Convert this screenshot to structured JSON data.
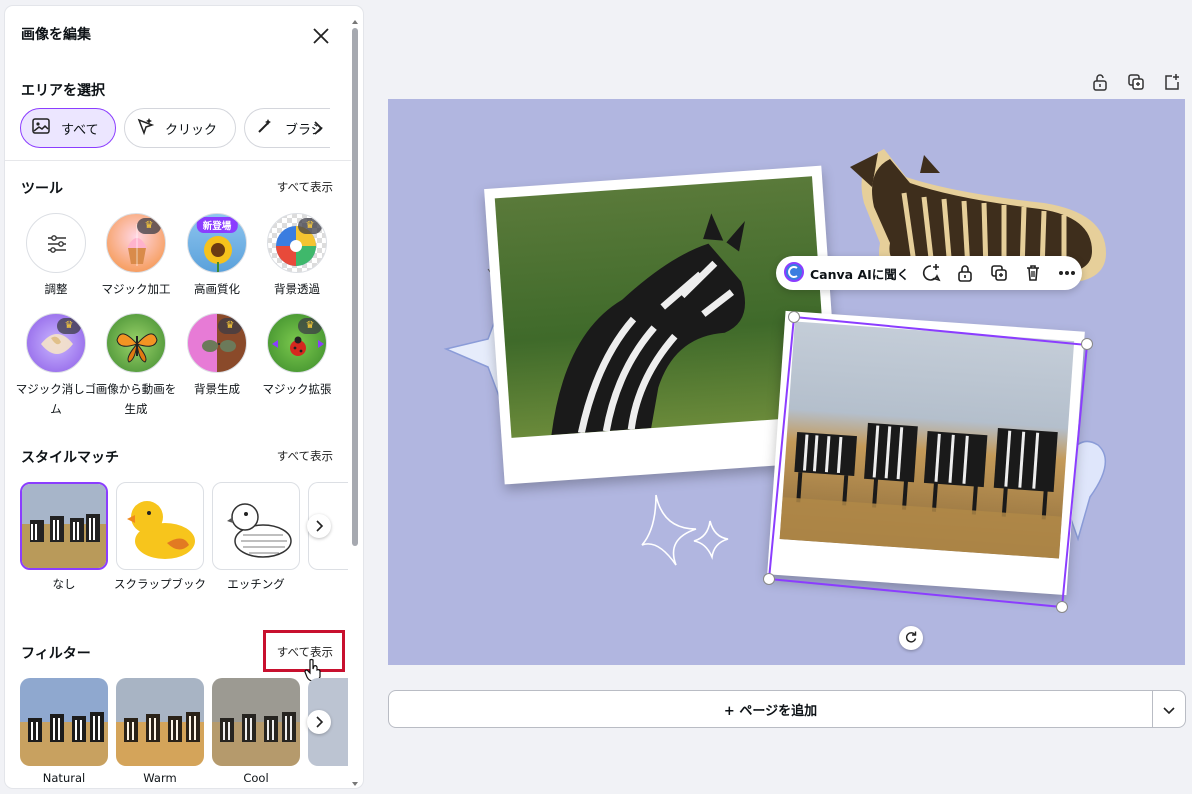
{
  "panel": {
    "title": "画像を編集",
    "area_section": {
      "title": "エリアを選択",
      "buttons": [
        {
          "label": "すべて",
          "icon": "image-icon",
          "active": true
        },
        {
          "label": "クリック",
          "icon": "magic-click-icon",
          "active": false
        },
        {
          "label": "ブラシ",
          "icon": "magic-brush-icon",
          "active": false
        }
      ]
    },
    "tools": {
      "title": "ツール",
      "show_all": "すべて表示",
      "items": [
        {
          "label": "調整",
          "icon": "sliders-icon",
          "premium": false
        },
        {
          "label": "マジック加工",
          "icon": "cupcake-thumbnail",
          "premium": true
        },
        {
          "label": "高画質化",
          "icon": "sunflower-thumbnail",
          "badge": "新登場"
        },
        {
          "label": "背景透過",
          "icon": "beach-ball-thumbnail",
          "premium": true
        },
        {
          "label": "マジック消しゴム",
          "icon": "eraser-thumbnail",
          "premium": true
        },
        {
          "label": "画像から動画を生成",
          "icon": "butterfly-thumbnail",
          "premium": false
        },
        {
          "label": "背景生成",
          "icon": "sunglasses-thumbnail",
          "premium": true
        },
        {
          "label": "マジック拡張",
          "icon": "ladybug-thumbnail",
          "premium": true
        }
      ]
    },
    "style_match": {
      "title": "スタイルマッチ",
      "show_all": "すべて表示",
      "items": [
        {
          "label": "なし",
          "selected": true
        },
        {
          "label": "スクラップブック",
          "selected": false
        },
        {
          "label": "エッチング",
          "selected": false
        }
      ]
    },
    "filters": {
      "title": "フィルター",
      "show_all": "すべて表示",
      "items": [
        {
          "label": "Natural"
        },
        {
          "label": "Warm"
        },
        {
          "label": "Cool"
        }
      ]
    }
  },
  "context_toolbar": {
    "ai_label": "Canva AIに聞く",
    "icons": [
      "comment-add-icon",
      "lock-icon",
      "duplicate-icon",
      "trash-icon",
      "more-icon"
    ]
  },
  "page_actions": [
    "lock-icon",
    "duplicate-page-icon",
    "add-page-icon"
  ],
  "add_page": {
    "label": "+ ページを追加"
  },
  "colors": {
    "accent": "#8b3dff",
    "canvas_bg": "#b1b6e0",
    "highlight": "#c8102e"
  }
}
